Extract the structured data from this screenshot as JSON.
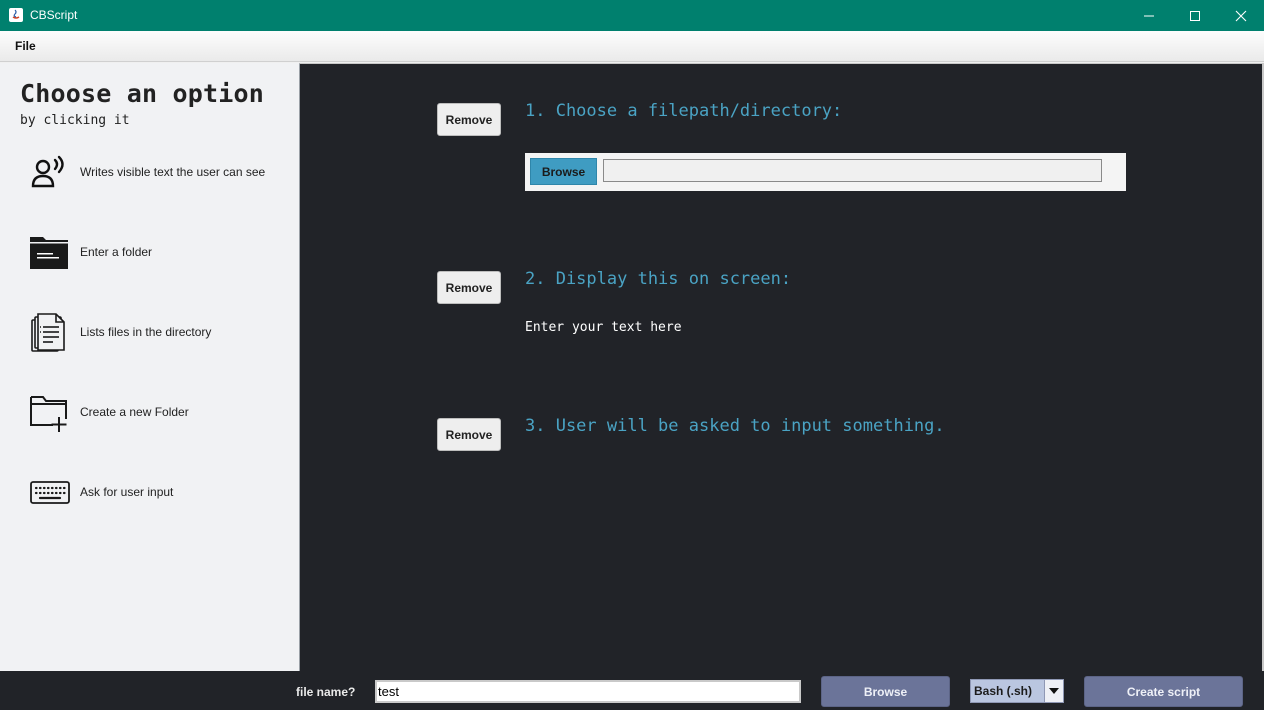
{
  "window": {
    "title": "CBScript"
  },
  "menu": {
    "file": "File"
  },
  "sidebar": {
    "title": "Choose an option",
    "subtitle": "by clicking it",
    "options": [
      {
        "label": "Writes visible text the user can see",
        "icon": "speaking-person-icon"
      },
      {
        "label": "Enter a folder",
        "icon": "folder-icon"
      },
      {
        "label": "Lists files in the directory",
        "icon": "file-list-icon"
      },
      {
        "label": "Create a new Folder",
        "icon": "new-folder-icon"
      },
      {
        "label": "Ask for user input",
        "icon": "keyboard-icon"
      }
    ]
  },
  "main": {
    "steps": [
      {
        "remove_label": "Remove",
        "text": "1. Choose a filepath/directory:",
        "browse_label": "Browse",
        "path_value": ""
      },
      {
        "remove_label": "Remove",
        "text": "2. Display this on screen:",
        "content": "Enter your text here"
      },
      {
        "remove_label": "Remove",
        "text": "3. User will be asked to input something."
      }
    ]
  },
  "bottom": {
    "file_name_label": "file name?",
    "file_name_value": "test",
    "browse_label": "Browse",
    "script_type": "Bash (.sh)",
    "create_label": "Create script"
  },
  "colors": {
    "titlebar": "#00806e",
    "main_bg": "#212328",
    "step_text": "#4aa3c4",
    "accent_button": "#6b7499"
  }
}
